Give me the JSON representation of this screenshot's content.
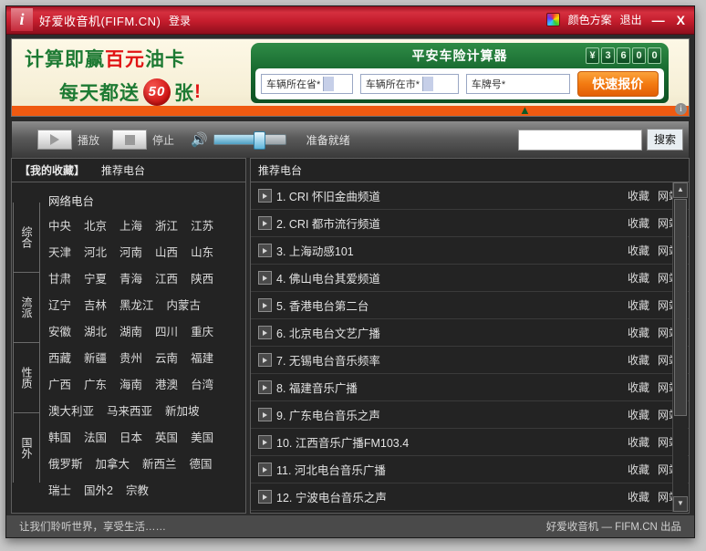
{
  "titlebar": {
    "app_title": "好爱收音机(FIFM.CN)",
    "login": "登录",
    "color_scheme": "颜色方案",
    "exit": "退出",
    "minimize": "—",
    "close": "X",
    "accent_color": "#c41c2c"
  },
  "banner": {
    "line1_a": "计算即赢",
    "line1_red": "百元",
    "line1_b": "油卡",
    "line2_a": "每天都送",
    "seal": "50",
    "line2_b": "张",
    "line2_excl": "!",
    "calculator_title": "平安车险计算器",
    "odometer": [
      "¥",
      "3",
      "6",
      "0",
      "0"
    ],
    "field_province": "车辆所在省*",
    "field_city": "车辆所在市*",
    "field_plate": "车牌号*",
    "quote_button": "快速报价",
    "info_badge": "i",
    "green": "#186b30",
    "orange": "#ef5a11"
  },
  "toolbar": {
    "play": "播放",
    "stop": "停止",
    "volume_percent": 62,
    "status": "准备就绪",
    "search_value": "",
    "search_placeholder": "",
    "search_button": "搜索"
  },
  "left_panel": {
    "tabs": [
      {
        "label": "【我的收藏】",
        "active": true
      },
      {
        "label": "推荐电台",
        "active": false
      }
    ],
    "categories": [
      "综合",
      "流派",
      "性质",
      "国外"
    ],
    "section_title": "网络电台",
    "region_rows": [
      [
        "中央",
        "北京",
        "上海",
        "浙江",
        "江苏"
      ],
      [
        "天津",
        "河北",
        "河南",
        "山西",
        "山东"
      ],
      [
        "甘肃",
        "宁夏",
        "青海",
        "江西",
        "陕西"
      ],
      [
        "辽宁",
        "吉林",
        "黑龙江",
        "内蒙古"
      ],
      [
        "安徽",
        "湖北",
        "湖南",
        "四川",
        "重庆"
      ],
      [
        "西藏",
        "新疆",
        "贵州",
        "云南",
        "福建"
      ],
      [
        "广西",
        "广东",
        "海南",
        "港澳",
        "台湾"
      ],
      [
        "澳大利亚",
        "马来西亚",
        "新加坡"
      ],
      [
        "韩国",
        "法国",
        "日本",
        "英国",
        "美国"
      ],
      [
        "俄罗斯",
        "加拿大",
        "新西兰",
        "德国"
      ],
      [
        "瑞士",
        "国外2",
        "宗教"
      ]
    ]
  },
  "right_panel": {
    "header": "推荐电台",
    "action_favorite": "收藏",
    "action_website": "网站",
    "stations": [
      {
        "index": "1.",
        "name": "CRI 怀旧金曲频道"
      },
      {
        "index": "2.",
        "name": "CRI 都市流行频道"
      },
      {
        "index": "3.",
        "name": "上海动感101"
      },
      {
        "index": "4.",
        "name": "佛山电台其爱频道"
      },
      {
        "index": "5.",
        "name": "香港电台第二台"
      },
      {
        "index": "6.",
        "name": "北京电台文艺广播"
      },
      {
        "index": "7.",
        "name": "无锡电台音乐频率"
      },
      {
        "index": "8.",
        "name": "福建音乐广播"
      },
      {
        "index": "9.",
        "name": "广东电台音乐之声"
      },
      {
        "index": "10.",
        "name": "江西音乐广播FM103.4"
      },
      {
        "index": "11.",
        "name": "河北电台音乐广播"
      },
      {
        "index": "12.",
        "name": "宁波电台音乐之声"
      }
    ],
    "scroll_up": "▲",
    "scroll_down": "▼"
  },
  "statusbar": {
    "left": "让我们聆听世界，享受生活……",
    "right": "好爱收音机 — FIFM.CN 出品"
  }
}
